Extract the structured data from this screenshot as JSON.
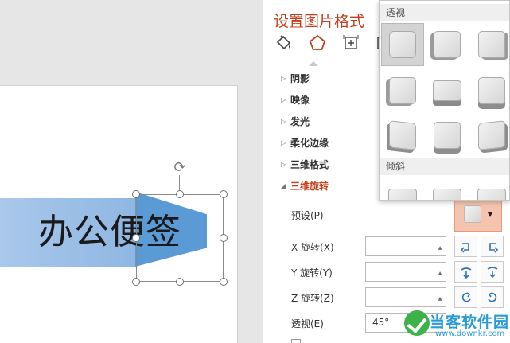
{
  "slide": {
    "shape_text": "办公便签"
  },
  "pane": {
    "title": "设置图片格式",
    "tabs": [
      {
        "name": "fill-line",
        "icon": "paint-bucket-icon"
      },
      {
        "name": "effects",
        "icon": "pentagon-icon",
        "active": true
      },
      {
        "name": "size-properties",
        "icon": "size-icon"
      },
      {
        "name": "picture",
        "icon": "picture-icon"
      }
    ],
    "sections": [
      {
        "label": "阴影",
        "expanded": false
      },
      {
        "label": "映像",
        "expanded": false
      },
      {
        "label": "发光",
        "expanded": false
      },
      {
        "label": "柔化边缘",
        "expanded": false
      },
      {
        "label": "三维格式",
        "expanded": false
      },
      {
        "label": "三维旋转",
        "expanded": true
      }
    ],
    "rotation": {
      "preset_label": "预设(P)",
      "x_label": "X 旋转(X)",
      "x_value": "",
      "y_label": "Y 旋转(Y)",
      "y_value": "",
      "z_label": "Z 旋转(Z)",
      "z_value": "",
      "perspective_label": "透视(E)",
      "perspective_value": "45°"
    }
  },
  "dropdown": {
    "group_perspective": "透视",
    "group_oblique": "倾斜"
  },
  "watermark": {
    "text": "当客软件园",
    "url": "www.downkr.com"
  },
  "colors": {
    "accent": "#c43e1c",
    "shape_light": "#8fb6e3",
    "shape_dark": "#5b9bd5",
    "preset_highlight": "#f6c4ae"
  }
}
